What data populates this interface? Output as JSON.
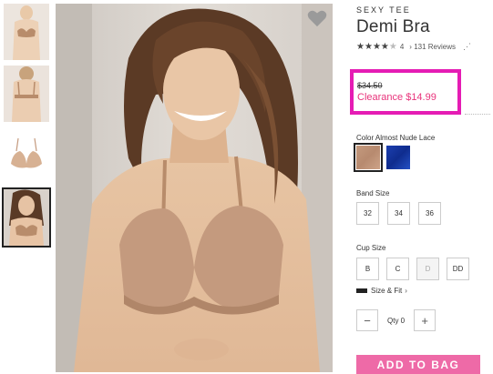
{
  "thumbnails": [
    {
      "name": "front-view"
    },
    {
      "name": "back-view"
    },
    {
      "name": "product-only"
    },
    {
      "name": "model-view",
      "selected": true
    }
  ],
  "product": {
    "collection": "SEXY TEE",
    "name": "Demi Bra",
    "rating": 4,
    "rating_max": 5,
    "rating_count": "4",
    "reviews_link": "131 Reviews",
    "share_icon": "share-icon"
  },
  "price": {
    "original": "$34.50",
    "clearance": "Clearance $14.99",
    "highlight_color": "#e51cb4"
  },
  "color": {
    "label": "Color Almost Nude Lace",
    "swatches": [
      {
        "name": "almost-nude-lace",
        "color": "#c49a7e",
        "selected": true
      },
      {
        "name": "blue",
        "color": "#1c3fb0"
      }
    ]
  },
  "band_size": {
    "label": "Band Size",
    "options": [
      "32",
      "34",
      "36"
    ]
  },
  "cup_size": {
    "label": "Cup Size",
    "options": [
      "B",
      "C",
      "D",
      "DD"
    ],
    "disabled": [
      "D"
    ]
  },
  "size_fit": {
    "label": "Size & Fit",
    "chevron": "›"
  },
  "quantity": {
    "label": "Qty 0",
    "minus": "−",
    "plus": "+"
  },
  "add_to_bag": {
    "label": "ADD TO BAG",
    "color": "#ee6aa7"
  }
}
